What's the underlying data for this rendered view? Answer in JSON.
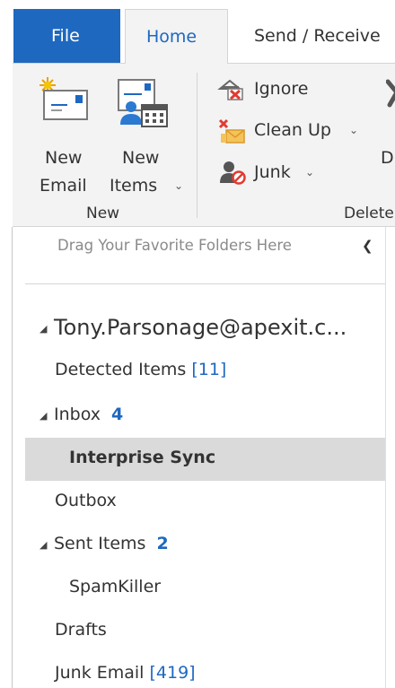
{
  "tabs": {
    "file": "File",
    "home": "Home",
    "send_receive": "Send / Receive"
  },
  "ribbon": {
    "new_email": {
      "line1": "New",
      "line2": "Email"
    },
    "new_items": {
      "line1": "New",
      "line2": "Items"
    },
    "new_group_label": "New",
    "ignore": "Ignore",
    "clean_up": "Clean Up",
    "junk": "Junk",
    "delete_partial": "D",
    "delete_group_label": "Delete"
  },
  "favorites_bar": {
    "text": "Drag Your Favorite Folders Here",
    "collapse_icon": "chevron-left-icon"
  },
  "folders": {
    "account": "Tony.Parsonage@apexit.c...",
    "detected_items": {
      "label": "Detected Items",
      "count": "[11]"
    },
    "inbox": {
      "label": "Inbox",
      "count": "4"
    },
    "interprise_sync": "Interprise Sync",
    "outbox": "Outbox",
    "sent_items": {
      "label": "Sent Items",
      "count": "2"
    },
    "spamkiller": "SpamKiller",
    "drafts": "Drafts",
    "junk_email": {
      "label": "Junk Email",
      "count": "[419]"
    }
  },
  "colors": {
    "accent_blue": "#1e68c0",
    "ribbon_bg": "#f3f3f3",
    "selected_row": "#dadada"
  }
}
